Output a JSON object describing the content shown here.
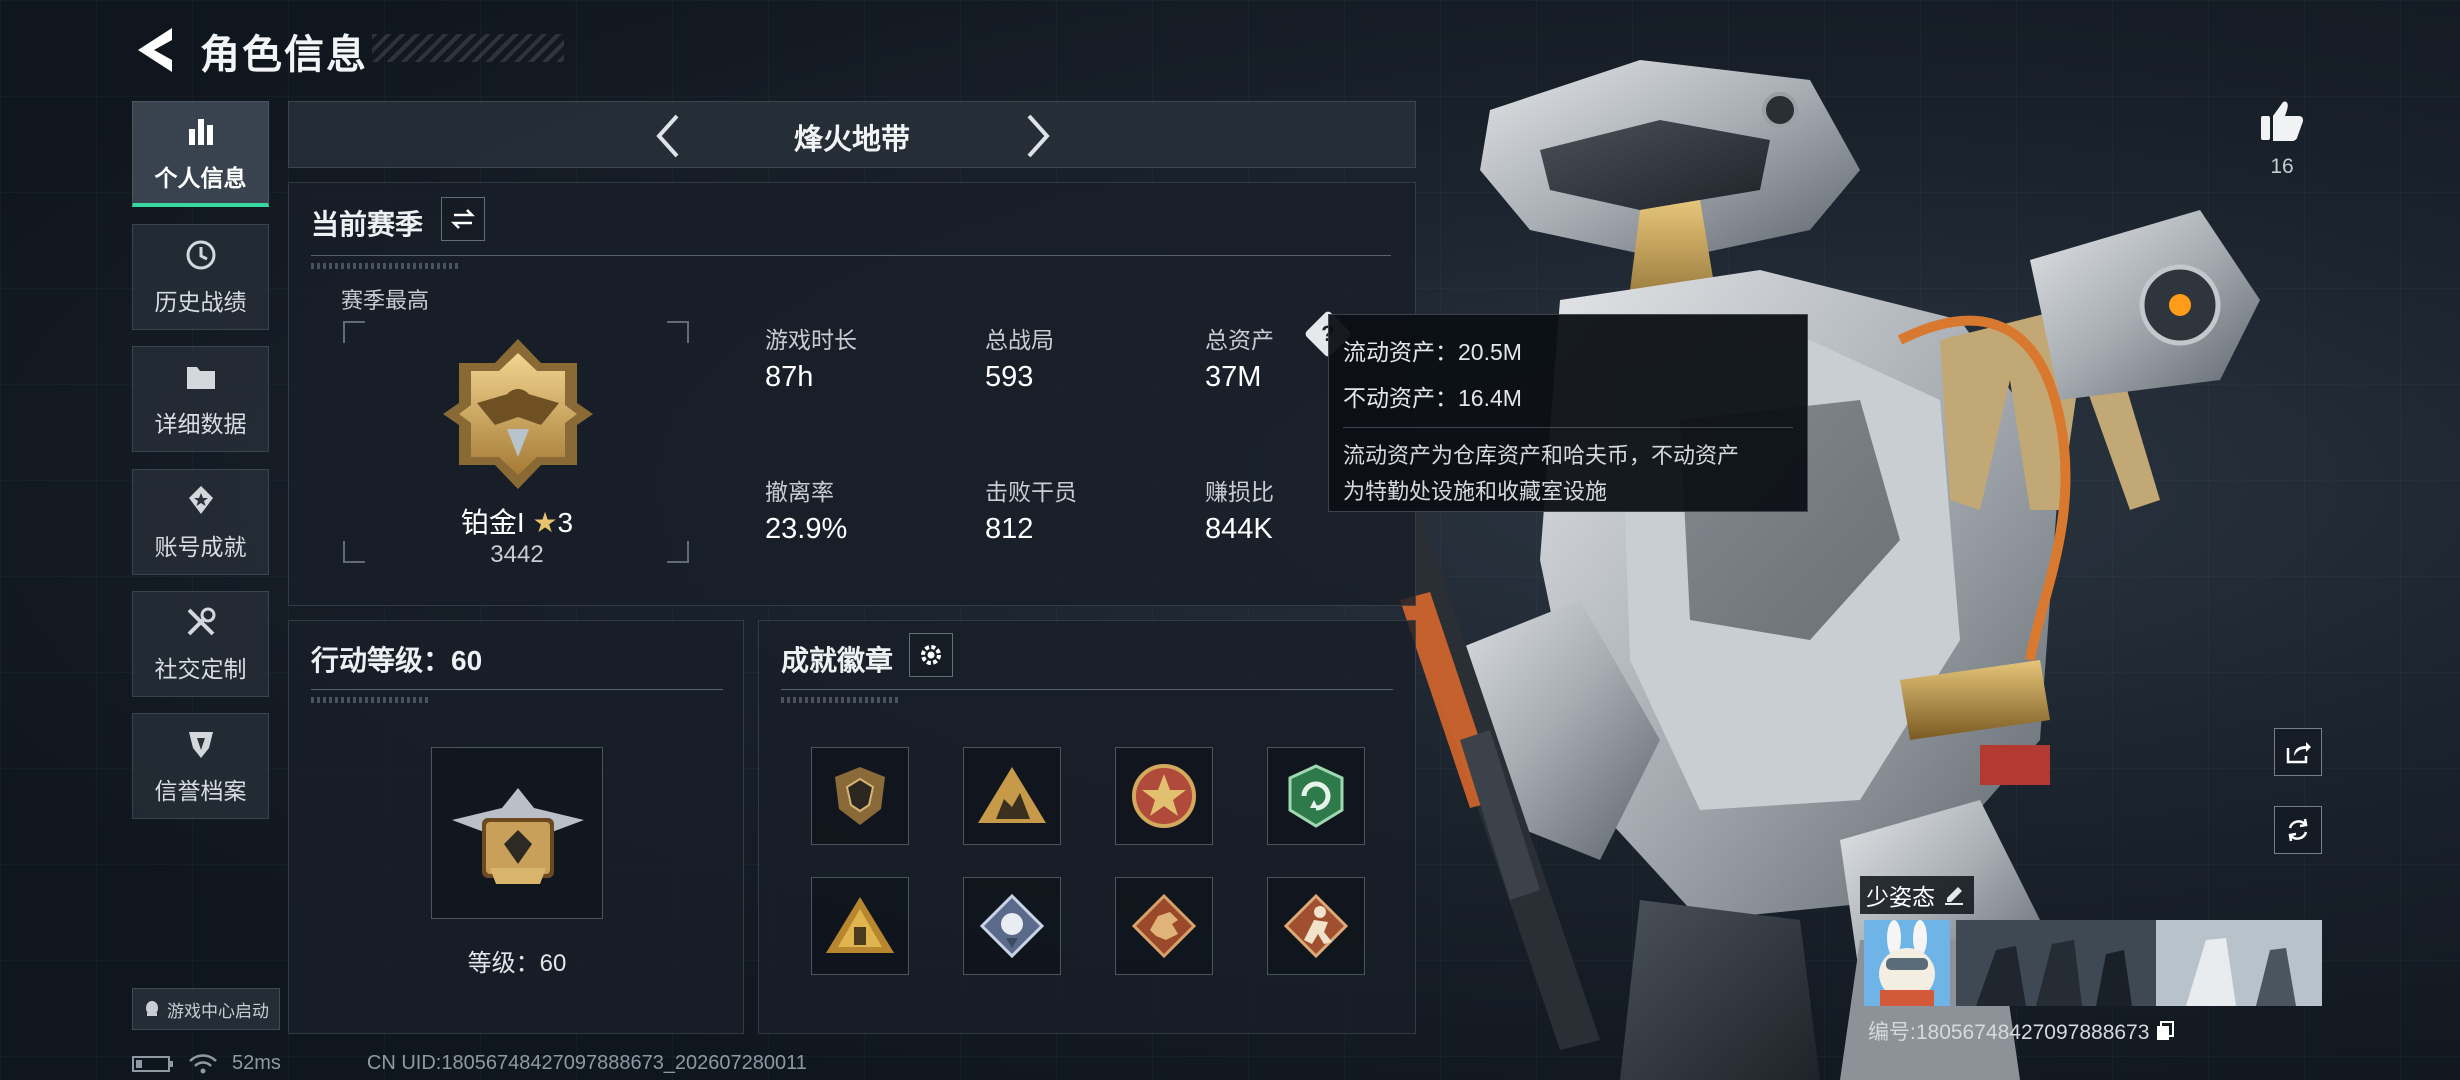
{
  "header": {
    "title": "角色信息"
  },
  "sidebar": {
    "items": [
      {
        "label": "个人信息",
        "icon": "bar-chart-icon",
        "active": true
      },
      {
        "label": "历史战绩",
        "icon": "history-icon",
        "active": false
      },
      {
        "label": "详细数据",
        "icon": "folder-icon",
        "active": false
      },
      {
        "label": "账号成就",
        "icon": "achievement-icon",
        "active": false
      },
      {
        "label": "社交定制",
        "icon": "tools-icon",
        "active": false
      },
      {
        "label": "信誉档案",
        "icon": "shield-icon",
        "active": false
      }
    ],
    "launch_label": "游戏中心启动"
  },
  "mode": {
    "name": "烽火地带"
  },
  "season": {
    "title": "当前赛季",
    "best_label": "赛季最高",
    "rank_name": "铂金I",
    "rank_stars": "3",
    "rank_score": "3442"
  },
  "stats": {
    "play_time": {
      "label": "游戏时长",
      "value": "87h"
    },
    "total_matches": {
      "label": "总战局",
      "value": "593"
    },
    "total_assets": {
      "label": "总资产",
      "value": "37M"
    },
    "extract_rate": {
      "label": "撤离率",
      "value": "23.9%"
    },
    "kills": {
      "label": "击败干员",
      "value": "812"
    },
    "profit_ratio": {
      "label": "赚损比",
      "value": "844K"
    }
  },
  "tooltip": {
    "liquid": "流动资产：20.5M",
    "fixed": "不动资产：16.4M",
    "desc_line1": "流动资产为仓库资产和哈夫币，不动资产",
    "desc_line2": "为特勤处设施和收藏室设施"
  },
  "action_level": {
    "title": "行动等级：60",
    "level_label": "等级：60"
  },
  "badges": {
    "title": "成就徽章",
    "items": [
      "shield-badge-icon",
      "triangle-badge-icon",
      "star-medal-badge-icon",
      "green-emblem-badge-icon",
      "pyramid-badge-icon",
      "diamond-rose-badge-icon",
      "dragon-badge-icon",
      "soldier-badge-icon"
    ]
  },
  "likes": {
    "count": "16"
  },
  "profile": {
    "name": "少姿态",
    "id_text": "编号:18056748427097888673"
  },
  "status": {
    "ping": "52ms",
    "uid": "CN UID:18056748427097888673_202607280011"
  },
  "colors": {
    "accent": "#37d8a0",
    "gold": "#c9a55a",
    "panel": "#181f28"
  }
}
